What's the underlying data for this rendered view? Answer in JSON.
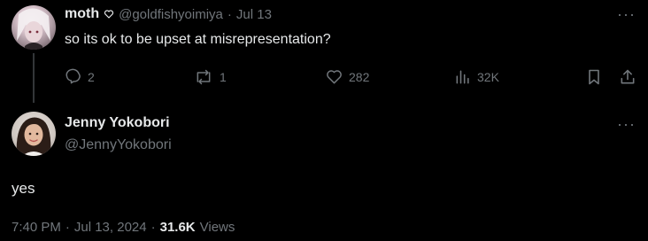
{
  "parent_tweet": {
    "author_name": "moth",
    "name_icon": "heart-outline-icon",
    "handle": "@goldfishyoimiya",
    "separator": "·",
    "date": "Jul 13",
    "text": "so its ok to be upset at misrepresentation?",
    "stats": {
      "replies": "2",
      "reposts": "1",
      "likes": "282",
      "views": "32K"
    }
  },
  "reply_tweet": {
    "author_name": "Jenny Yokobori",
    "handle": "@JennyYokobori",
    "text": "yes",
    "time": "7:40 PM",
    "date": "Jul 13, 2024",
    "views_count": "31.6K",
    "views_label": "Views",
    "separator": "·"
  },
  "colors": {
    "background": "#000000",
    "text_primary": "#e7e9ea",
    "text_secondary": "#71767b",
    "thread_line": "#333639"
  }
}
